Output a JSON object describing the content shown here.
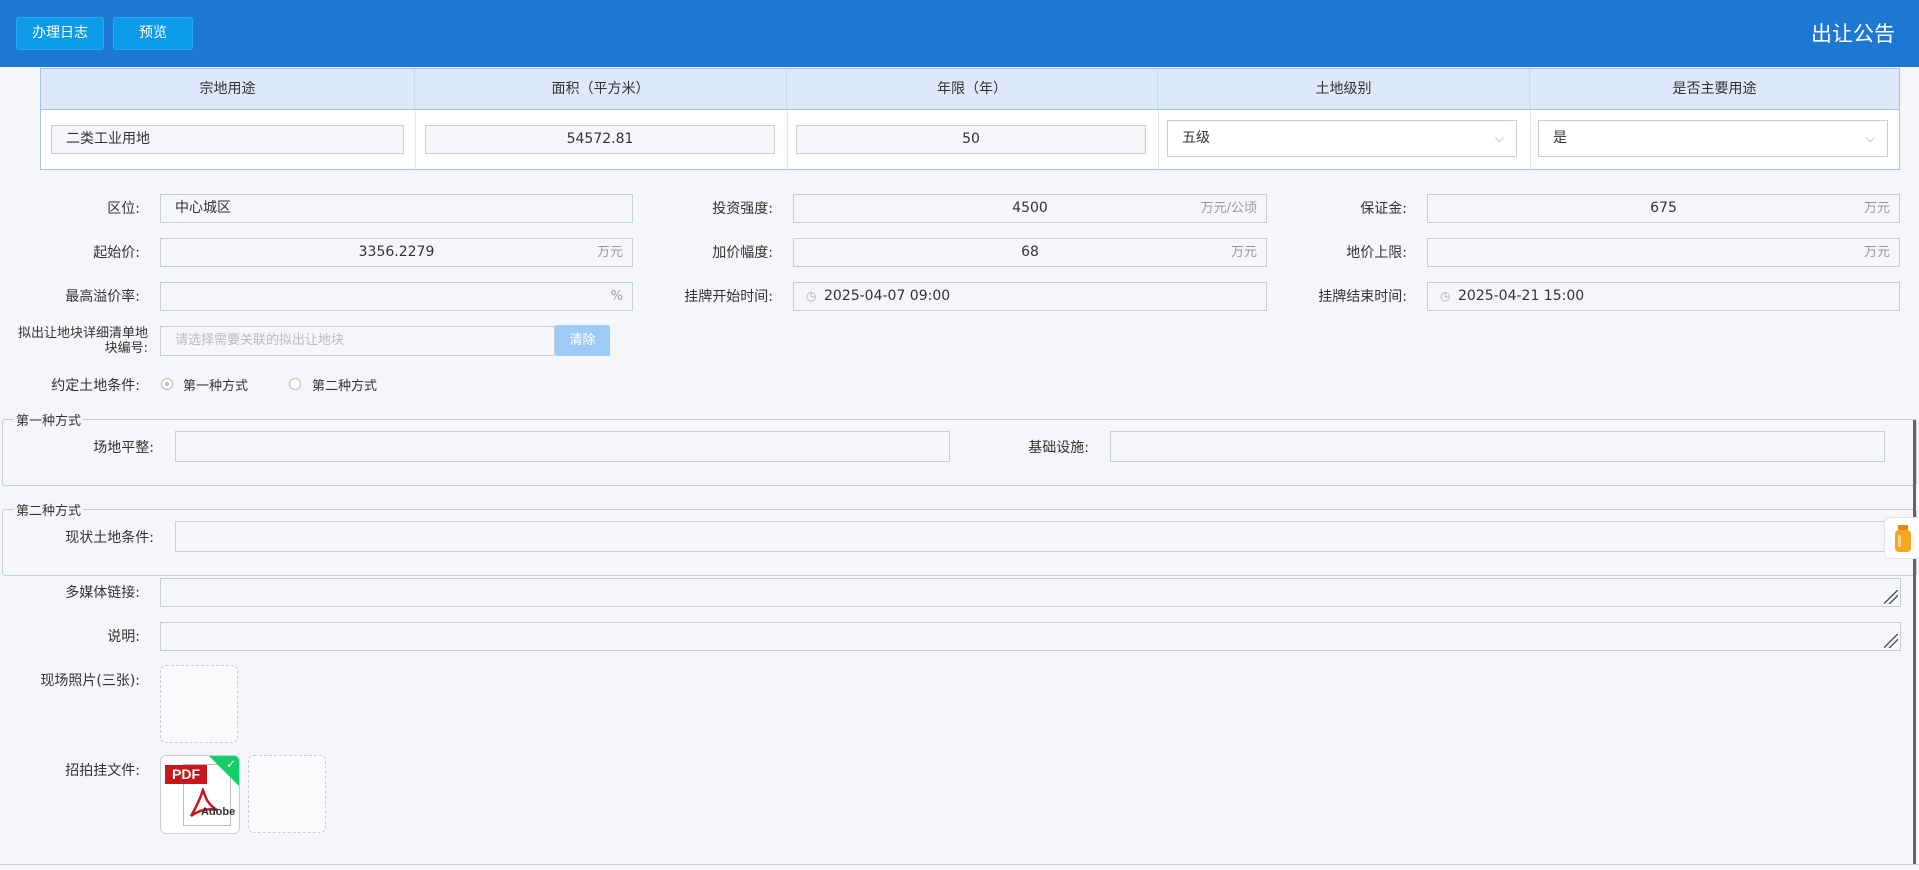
{
  "toolbar": {
    "log_label": "办理日志",
    "preview_label": "预览",
    "title": "出让公告"
  },
  "land_table": {
    "headers": [
      "宗地用途",
      "面积（平方米）",
      "年限（年）",
      "土地级别",
      "是否主要用途"
    ],
    "row": {
      "usage": "二类工业用地",
      "area": "54572.81",
      "years": "50",
      "grade": "五级",
      "is_main": "是"
    }
  },
  "form": {
    "location": {
      "label": "区位:",
      "value": "中心城区"
    },
    "investment": {
      "label": "投资强度:",
      "value": "4500",
      "unit": "万元/公顷"
    },
    "deposit": {
      "label": "保证金:",
      "value": "675",
      "unit": "万元"
    },
    "start_price": {
      "label": "起始价:",
      "value": "3356.2279",
      "unit": "万元"
    },
    "increment": {
      "label": "加价幅度:",
      "value": "68",
      "unit": "万元"
    },
    "price_cap": {
      "label": "地价上限:",
      "value": "",
      "unit": "万元"
    },
    "max_premium": {
      "label": "最高溢价率:",
      "value": "",
      "unit": "%"
    },
    "listing_start": {
      "label": "挂牌开始时间:",
      "value": "2025-04-07 09:00"
    },
    "listing_end": {
      "label": "挂牌结束时间:",
      "value": "2025-04-21 15:00"
    },
    "parcel_list": {
      "label_line1": "拟出让地块详细清单地",
      "label_line2": "块编号:",
      "placeholder": "请选择需要关联的拟出让地块",
      "clear_label": "清除"
    },
    "land_condition": {
      "label": "约定土地条件:",
      "option1": "第一种方式",
      "option2": "第二种方式",
      "selected": "第一种方式"
    },
    "method1": {
      "legend": "第一种方式",
      "site_leveling_label": "场地平整:",
      "infrastructure_label": "基础设施:"
    },
    "method2": {
      "legend": "第二种方式",
      "current_condition_label": "现状土地条件:"
    },
    "multimedia": {
      "label": "多媒体链接:"
    },
    "description": {
      "label": "说明:"
    },
    "photos": {
      "label": "现场照片(三张):"
    },
    "auction_file": {
      "label": "招拍挂文件:",
      "file_badge": "PDF",
      "file_brand": "Adobe",
      "status": "uploaded"
    }
  }
}
